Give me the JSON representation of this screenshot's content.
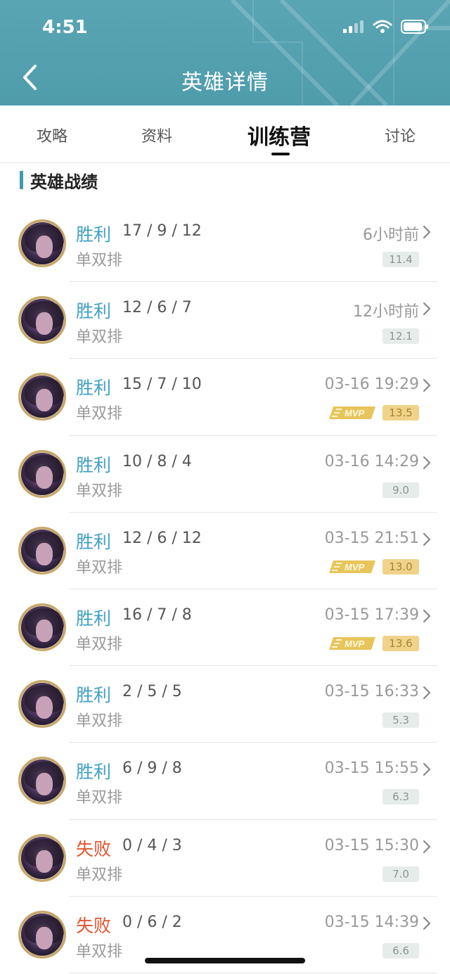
{
  "status_bar": {
    "time": "4:51"
  },
  "header": {
    "title": "英雄详情"
  },
  "tabs": [
    {
      "label": "攻略",
      "active": false
    },
    {
      "label": "资料",
      "active": false
    },
    {
      "label": "训练营",
      "active": true
    },
    {
      "label": "讨论",
      "active": false
    }
  ],
  "section": {
    "title": "英雄战绩"
  },
  "colors": {
    "win": "#3fa0c4",
    "lose": "#e0562f",
    "header": "#4f9cab",
    "accent_bar": "#3e9aae"
  },
  "matches": [
    {
      "result": "胜利",
      "outcome": "win",
      "kda": "17 / 9 / 12",
      "mode": "单双排",
      "time": "6小时前",
      "mvp": false,
      "score": "11.4"
    },
    {
      "result": "胜利",
      "outcome": "win",
      "kda": "12 / 6 / 7",
      "mode": "单双排",
      "time": "12小时前",
      "mvp": false,
      "score": "12.1"
    },
    {
      "result": "胜利",
      "outcome": "win",
      "kda": "15 / 7 / 10",
      "mode": "单双排",
      "time": "03-16 19:29",
      "mvp": true,
      "score": "13.5"
    },
    {
      "result": "胜利",
      "outcome": "win",
      "kda": "10 / 8 / 4",
      "mode": "单双排",
      "time": "03-16 14:29",
      "mvp": false,
      "score": "9.0"
    },
    {
      "result": "胜利",
      "outcome": "win",
      "kda": "12 / 6 / 12",
      "mode": "单双排",
      "time": "03-15 21:51",
      "mvp": true,
      "score": "13.0"
    },
    {
      "result": "胜利",
      "outcome": "win",
      "kda": "16 / 7 / 8",
      "mode": "单双排",
      "time": "03-15 17:39",
      "mvp": true,
      "score": "13.6"
    },
    {
      "result": "胜利",
      "outcome": "win",
      "kda": "2 / 5 / 5",
      "mode": "单双排",
      "time": "03-15 16:33",
      "mvp": false,
      "score": "5.3"
    },
    {
      "result": "胜利",
      "outcome": "win",
      "kda": "6 / 9 / 8",
      "mode": "单双排",
      "time": "03-15 15:55",
      "mvp": false,
      "score": "6.3"
    },
    {
      "result": "失败",
      "outcome": "lose",
      "kda": "0 / 4 / 3",
      "mode": "单双排",
      "time": "03-15 15:30",
      "mvp": false,
      "score": "7.0"
    },
    {
      "result": "失败",
      "outcome": "lose",
      "kda": "0 / 6 / 2",
      "mode": "单双排",
      "time": "03-15 14:39",
      "mvp": false,
      "score": "6.6"
    }
  ],
  "icons": {
    "back": "chevron-left-icon",
    "row_chevron": "chevron-right-icon",
    "mvp": "mvp-badge-icon",
    "signal": "signal-icon",
    "wifi": "wifi-icon",
    "battery": "battery-icon"
  }
}
